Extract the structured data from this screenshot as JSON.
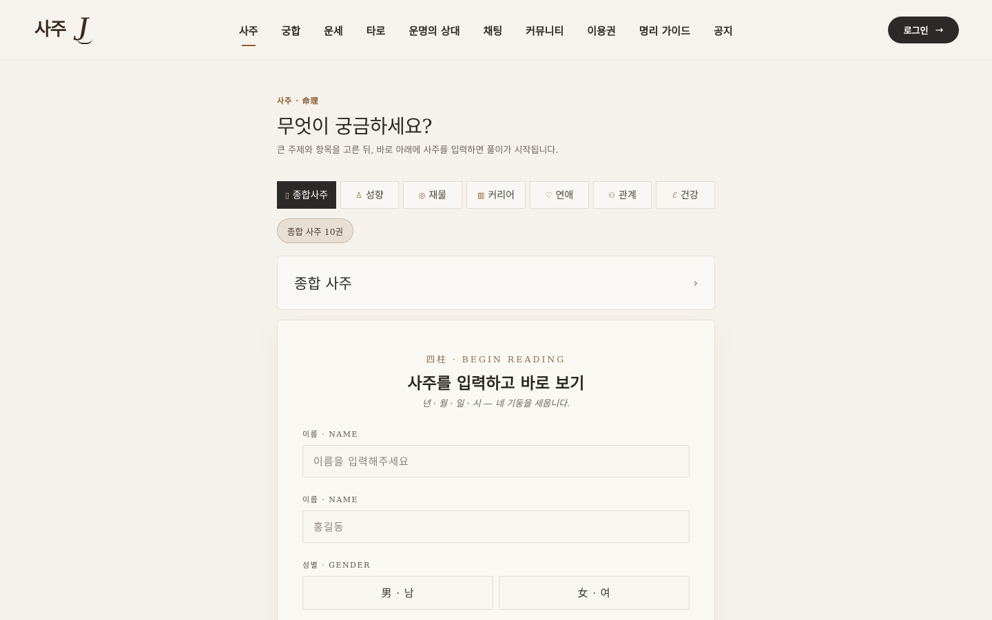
{
  "header": {
    "logo_text": "사주J",
    "nav": [
      {
        "label": "사주",
        "active": true
      },
      {
        "label": "궁합",
        "active": false
      },
      {
        "label": "운세",
        "active": false
      },
      {
        "label": "타로",
        "active": false
      },
      {
        "label": "운명의 상대",
        "active": false
      },
      {
        "label": "채팅",
        "active": false
      },
      {
        "label": "커뮤니티",
        "active": false
      },
      {
        "label": "이용권",
        "active": false
      },
      {
        "label": "명리 가이드",
        "active": false
      },
      {
        "label": "공지",
        "active": false
      }
    ],
    "login_label": "로그인"
  },
  "intro": {
    "eyebrow": "사주 · 命理",
    "title": "무엇이 궁금하세요?",
    "subtitle": "큰 주제와 항목을 고른 뒤, 바로 아래에 사주를 입력하면 풀이가 시작됩니다."
  },
  "tabs": [
    {
      "label": "종합사주",
      "icon": "book-icon",
      "glyph": "▯",
      "active": true
    },
    {
      "label": "성향",
      "icon": "person-icon",
      "glyph": "♙",
      "active": false
    },
    {
      "label": "재물",
      "icon": "coins-icon",
      "glyph": "◎",
      "active": false
    },
    {
      "label": "커리어",
      "icon": "building-icon",
      "glyph": "▥",
      "active": false
    },
    {
      "label": "연애",
      "icon": "heart-icon",
      "glyph": "♡",
      "active": false
    },
    {
      "label": "관계",
      "icon": "people-icon",
      "glyph": "⚇",
      "active": false
    },
    {
      "label": "건강",
      "icon": "leaf-icon",
      "glyph": "ℰ",
      "active": false
    }
  ],
  "sub_pill": "종합 사주 10권",
  "topic": {
    "title": "종합 사주"
  },
  "form": {
    "eyebrow": "四柱 · BEGIN READING",
    "title": "사주를 입력하고 바로 보기",
    "subtitle": "년 · 월 · 일 · 시 — 네 기둥을 세웁니다.",
    "name_label": "이름 · NAME",
    "name_placeholder": "이름을 입력해주세요",
    "name2_label": "이름 · NAME",
    "name2_placeholder": "홍길동",
    "gender_label": "성별 · GENDER",
    "gender_male": "男 · 남",
    "gender_female": "女 · 여"
  },
  "colors": {
    "background": "#f5f2ec",
    "accent": "#8b5a33",
    "dark": "#2b2a28"
  }
}
